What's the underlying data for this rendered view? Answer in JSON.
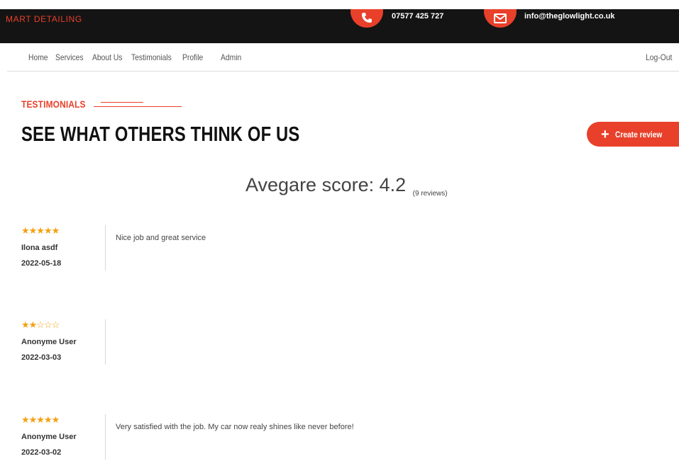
{
  "header": {
    "brand": "MART DETAILING",
    "phone": "07577 425 727",
    "email": "info@theglowlight.co.uk",
    "accent_color": "#e8402a",
    "bar_color": "#141414"
  },
  "nav": {
    "items": [
      {
        "label": "Home"
      },
      {
        "label": "Services"
      },
      {
        "label": "About Us"
      },
      {
        "label": "Testimonials"
      },
      {
        "label": "Profile"
      },
      {
        "label": "Admin"
      }
    ],
    "logout": "Log-Out"
  },
  "section": {
    "label": "TESTIMONIALS",
    "title": "SEE WHAT OTHERS THINK OF US",
    "create_button": "Create review"
  },
  "score": {
    "text": "Avegare score: 4.2",
    "count": "(9 reviews)"
  },
  "reviews": [
    {
      "stars": "★★★★★",
      "rating": 5,
      "name": "Ilona asdf",
      "date": "2022-05-18",
      "text": "Nice job and great service"
    },
    {
      "stars": "★★☆☆☆",
      "rating": 2,
      "name": "Anonyme User",
      "date": "2022-03-03",
      "text": ""
    },
    {
      "stars": "★★★★★",
      "rating": 5,
      "name": "Anonyme User",
      "date": "2022-03-02",
      "text": "Very satisfied with the job. My car now realy shines like never before!"
    }
  ],
  "icons": {
    "phone": "phone-icon",
    "email": "mail-icon",
    "create": "plus-icon",
    "star_color": "#f4a012"
  }
}
